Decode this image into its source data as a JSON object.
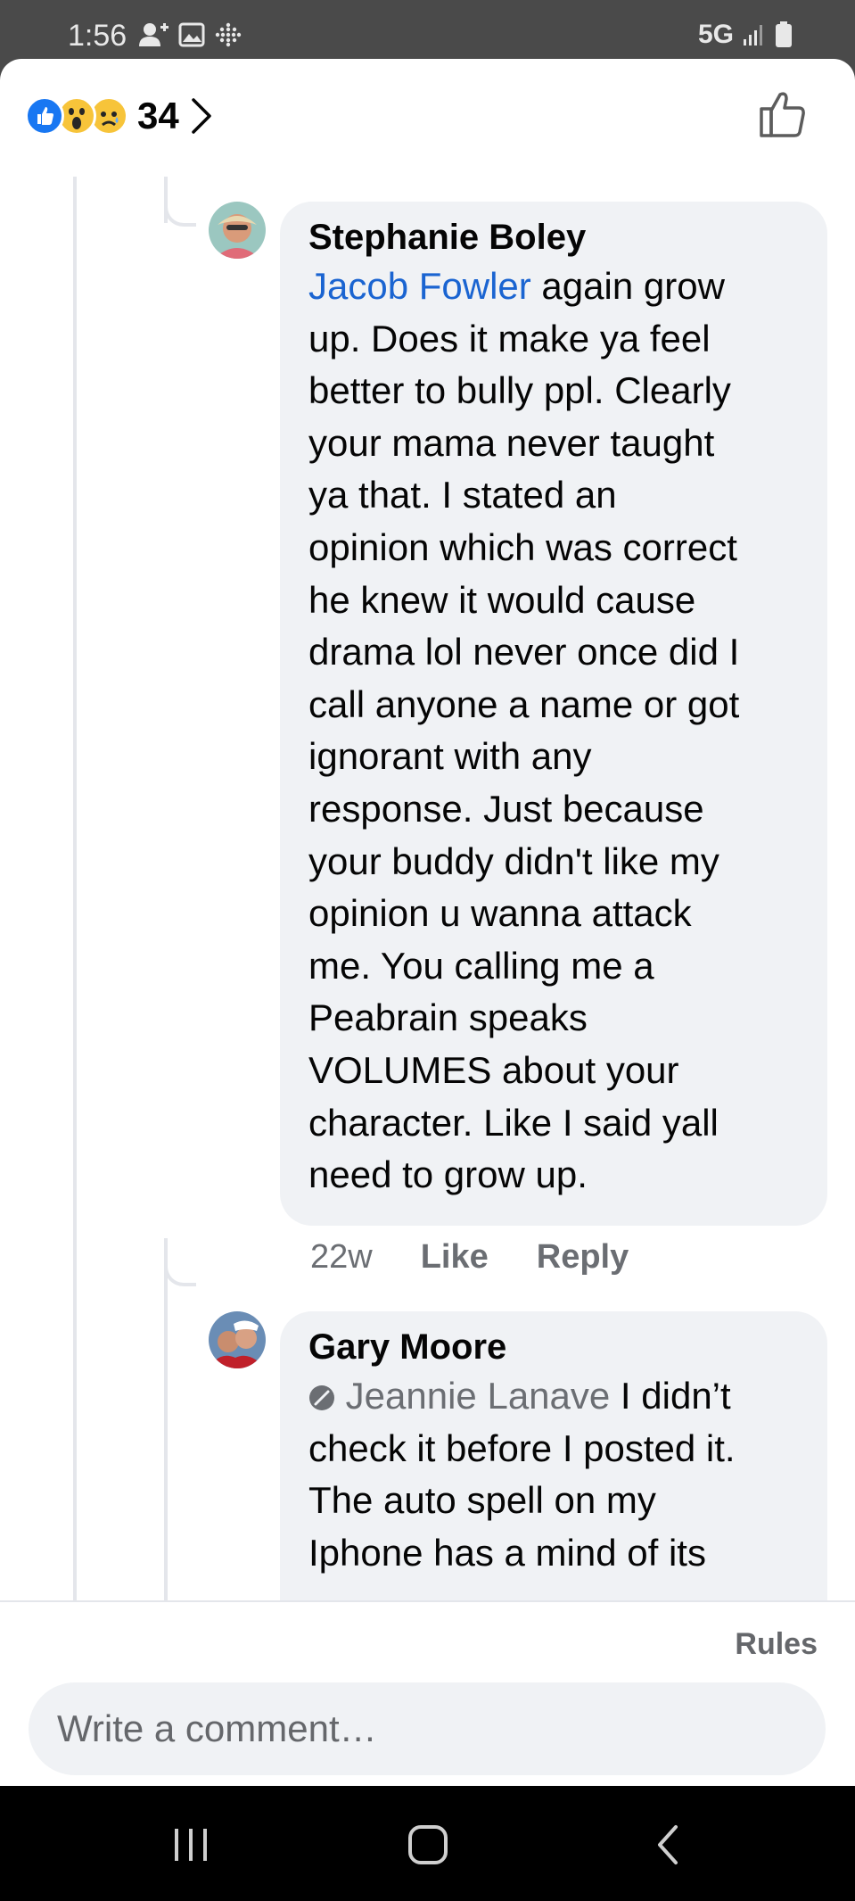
{
  "status_bar": {
    "time": "1:56",
    "network": "5G"
  },
  "header": {
    "reactions": [
      "like",
      "wow",
      "sad"
    ],
    "reaction_count": "34"
  },
  "comments": [
    {
      "author": "Stephanie Boley",
      "mention": "Jacob Fowler",
      "text_lines": [
        " again grow",
        "up. Does it make ya feel",
        "better to bully ppl. Clearly",
        "your mama never taught",
        "ya that. I stated an",
        "opinion which was correct",
        "he knew it would cause",
        "drama lol never once did I",
        "call anyone a name or got",
        "ignorant with any",
        "response. Just because",
        "your buddy didn't like my",
        "opinion u wanna attack",
        "me. You calling me a",
        "Peabrain speaks",
        "VOLUMES about your",
        "character. Like I said yall",
        "need to grow up."
      ],
      "time": "22w",
      "like_label": "Like",
      "reply_label": "Reply"
    },
    {
      "author": "Gary Moore",
      "mention": "Jeannie Lanave",
      "text_lines": [
        " I didn’t",
        "check it before I posted it.",
        "The auto spell on my",
        "Iphone has a mind of its"
      ]
    }
  ],
  "footer": {
    "rules_label": "Rules",
    "comment_placeholder": "Write a comment…"
  },
  "colors": {
    "accent_blue": "#1877f2",
    "mention_blue": "#1a64d1",
    "bubble_bg": "#f0f2f5",
    "muted_text": "#65676b"
  }
}
